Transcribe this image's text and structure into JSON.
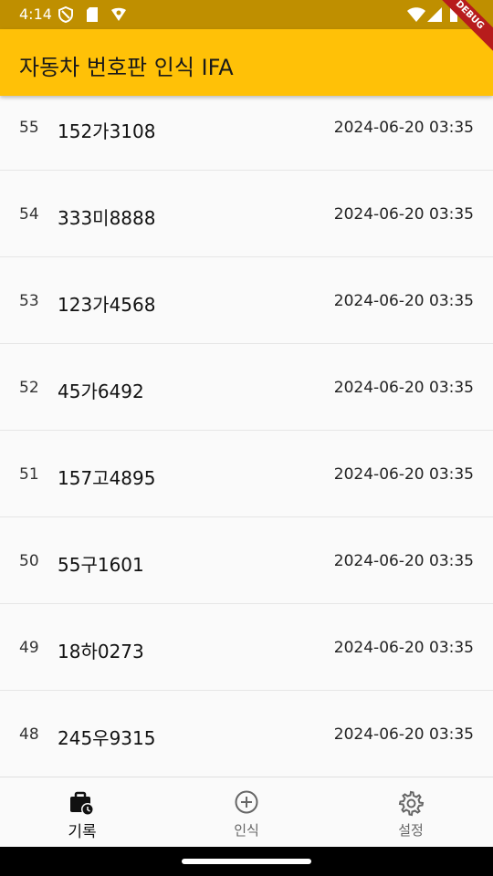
{
  "status_bar": {
    "time": "4:14",
    "left_icons": [
      "vpn-shield-icon",
      "sd-card-icon",
      "notification-icon"
    ],
    "right_icons": [
      "wifi-icon",
      "signal-icon",
      "battery-icon"
    ]
  },
  "debug_banner": "DEBUG",
  "app_bar": {
    "title": "자동차 번호판 인식 IFA",
    "color": "#ffc107"
  },
  "records": [
    {
      "index": "55",
      "plate": "152가3108",
      "timestamp": "2024-06-20 03:35"
    },
    {
      "index": "54",
      "plate": "333미8888",
      "timestamp": "2024-06-20 03:35"
    },
    {
      "index": "53",
      "plate": "123가4568",
      "timestamp": "2024-06-20 03:35"
    },
    {
      "index": "52",
      "plate": "45가6492",
      "timestamp": "2024-06-20 03:35"
    },
    {
      "index": "51",
      "plate": "157고4895",
      "timestamp": "2024-06-20 03:35"
    },
    {
      "index": "50",
      "plate": "55구1601",
      "timestamp": "2024-06-20 03:35"
    },
    {
      "index": "49",
      "plate": "18하0273",
      "timestamp": "2024-06-20 03:35"
    },
    {
      "index": "48",
      "plate": "245우9315",
      "timestamp": "2024-06-20 03:35"
    }
  ],
  "bottom_nav": {
    "items": [
      {
        "label": "기록",
        "icon": "history-briefcase-icon",
        "active": true
      },
      {
        "label": "인식",
        "icon": "add-circle-icon",
        "active": false
      },
      {
        "label": "설정",
        "icon": "settings-gear-icon",
        "active": false
      }
    ]
  }
}
